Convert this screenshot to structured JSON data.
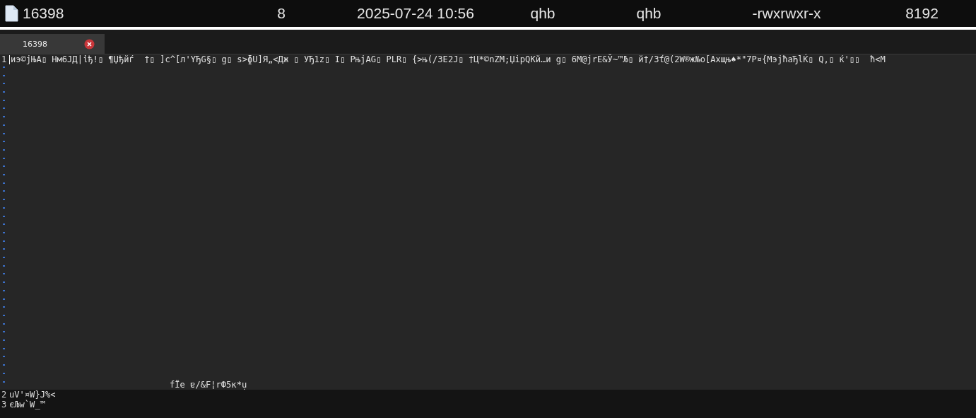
{
  "file_row": {
    "name": "16398",
    "links": "8",
    "modified": "2025-07-24 10:56",
    "owner": "qhb",
    "group": "qhb",
    "permissions": "-rwxrwxr-x",
    "size": "8192"
  },
  "tabs": [
    {
      "label": "16398",
      "selected": true
    }
  ],
  "editor": {
    "lines": [
      {
        "number": "1",
        "current": true,
        "text": "иэ©jЊA▯ Hм6JД|ἰђ!▯ ¶Џђйѓ  †▯ ]c^[л'YЂG§▯ g▯ s>ɸU]Я„<Дж ▯ УЂ1z▯ I▯ PњjAG▯ PLR▯ {>њ(/3E2J▯ †Ц*©nZM;ЏipQKй…и g▯ 6M@jrE&Ў~™Љ▯ й†/3ť@(2W®ж№o[Axщњ♠*\"7P¤{MэjħaЂlЌ▯ Q,▯ ќ'▯▯  ħ<M",
        "continuation": "fЇe ɐ/&F¦rФ5ĸ*ụ"
      },
      {
        "number": "2",
        "current": false,
        "text": "uV'¤W}J%<"
      },
      {
        "number": "3",
        "current": false,
        "text": "єЉw`W_™"
      }
    ]
  }
}
